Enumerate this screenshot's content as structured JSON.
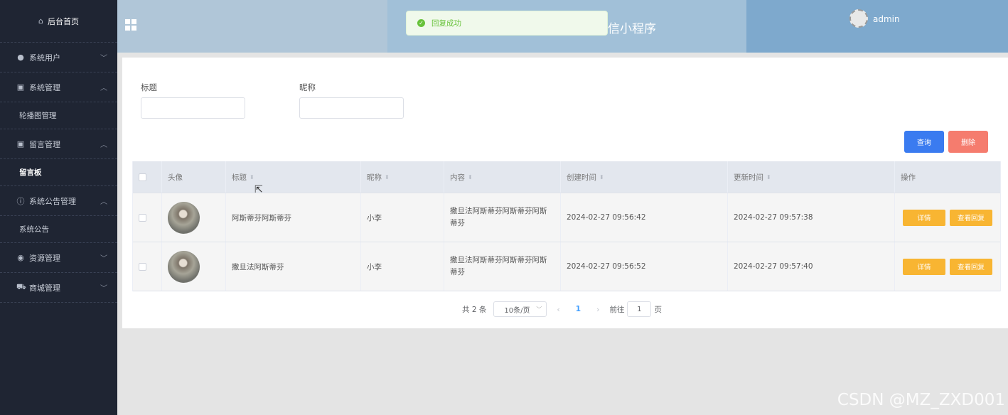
{
  "sidebar": {
    "home": "后台首页",
    "items": [
      {
        "label": "系统用户",
        "icon": "user-icon",
        "chevron": "﹀"
      },
      {
        "label": "系统管理",
        "icon": "image-icon",
        "chevron": "︿"
      },
      {
        "sub": "轮播图管理"
      },
      {
        "label": "留言管理",
        "icon": "image-icon",
        "chevron": "︿"
      },
      {
        "sub": "留言板"
      },
      {
        "label": "系统公告管理",
        "icon": "info-icon",
        "chevron": "︿"
      },
      {
        "sub": "系统公告"
      },
      {
        "label": "资源管理",
        "icon": "location-icon",
        "chevron": "﹀"
      },
      {
        "label": "商城管理",
        "icon": "cart-icon",
        "chevron": "﹀"
      }
    ]
  },
  "header": {
    "title": "信小程序",
    "username": "admin",
    "colors": {
      "left": "#b0c6d8",
      "mid": "#a1c0d8",
      "right": "#7ea9cd"
    }
  },
  "toast": {
    "message": "回复成功"
  },
  "filters": {
    "title_label": "标题",
    "nickname_label": "昵称"
  },
  "buttons": {
    "query": "查询",
    "delete": "删除"
  },
  "table": {
    "columns": [
      "头像",
      "标题",
      "昵称",
      "内容",
      "创建时间",
      "更新时间",
      "操作"
    ],
    "rows": [
      {
        "title": "阿斯蒂芬阿斯蒂芬",
        "nickname": "小李",
        "content": "撒旦法阿斯蒂芬阿斯蒂芬阿斯蒂芬",
        "created": "2024-02-27 09:56:42",
        "updated": "2024-02-27 09:57:38",
        "detail": "详情",
        "reply": "查看回复"
      },
      {
        "title": "撒旦法阿斯蒂芬",
        "nickname": "小李",
        "content": "撒旦法阿斯蒂芬阿斯蒂芬阿斯蒂芬",
        "created": "2024-02-27 09:56:52",
        "updated": "2024-02-27 09:57:40",
        "detail": "详情",
        "reply": "查看回复"
      }
    ]
  },
  "pagination": {
    "total": "共 2 条",
    "page_size": "10条/页",
    "current": "1",
    "goto_prefix": "前往",
    "goto_value": "1",
    "goto_suffix": "页"
  },
  "watermark": "CSDN @MZ_ZXD001"
}
